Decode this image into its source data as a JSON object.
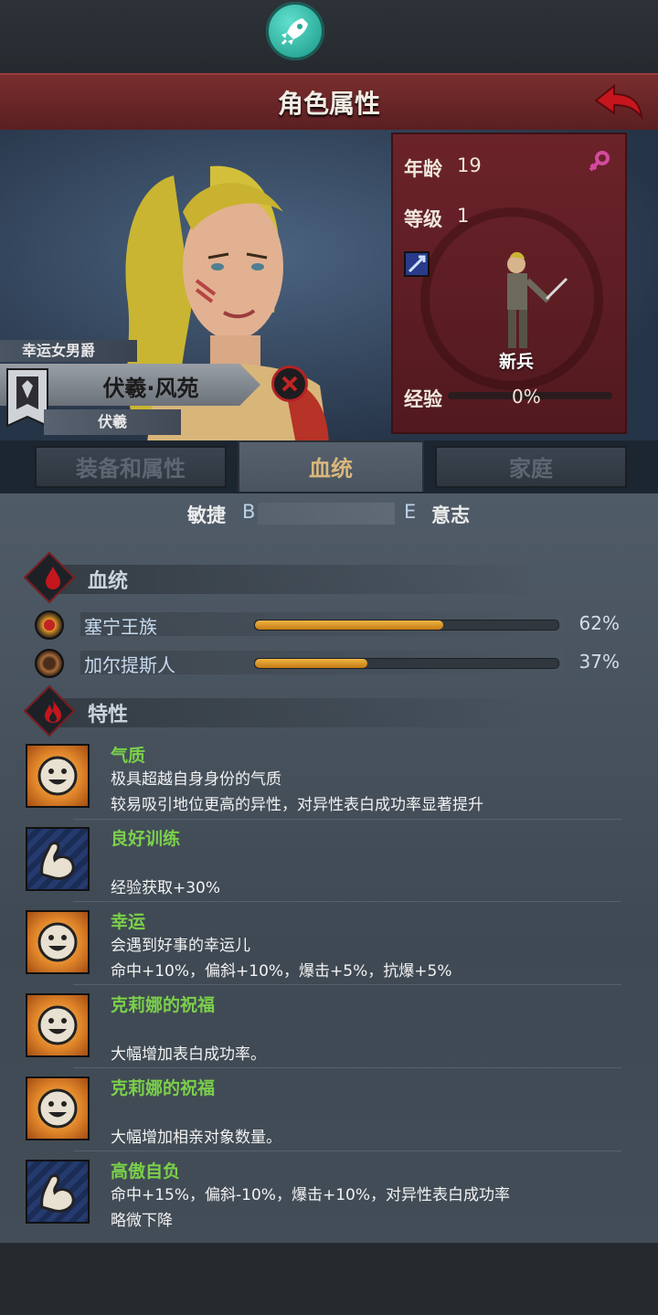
{
  "header": {
    "title": "角色属性"
  },
  "character": {
    "title": "幸运女男爵",
    "name": "伏羲·风苑",
    "dynasty": "伏羲"
  },
  "stats": {
    "age_label": "年龄",
    "age_value": "19",
    "level_label": "等级",
    "level_value": "1",
    "rank": "新兵",
    "exp_label": "经验",
    "exp_value": "0%"
  },
  "tabs": [
    {
      "label": "装备和属性"
    },
    {
      "label": "血统"
    },
    {
      "label": "家庭"
    }
  ],
  "slider": {
    "left_label": "敏捷",
    "left_grade": "B",
    "right_grade": "E",
    "right_label": "意志"
  },
  "bloodline_section": {
    "title": "血统"
  },
  "bloodlines": [
    {
      "name": "塞宁王族",
      "percent": 0.62,
      "percent_label": "62%"
    },
    {
      "name": "加尔提斯人",
      "percent": 0.37,
      "percent_label": "37%"
    }
  ],
  "traits_section": {
    "title": "特性"
  },
  "traits": [
    {
      "icon": "smile-icon",
      "name": "气质",
      "lines": [
        "极具超越自身身份的气质",
        "较易吸引地位更高的异性，对异性表白成功率显著提升"
      ]
    },
    {
      "icon": "arm-icon",
      "name": "良好训练",
      "lines": [
        "",
        "经验获取+30%"
      ]
    },
    {
      "icon": "smile-icon",
      "name": "幸运",
      "lines": [
        "会遇到好事的幸运儿",
        "命中+10%，偏斜+10%，爆击+5%，抗爆+5%"
      ]
    },
    {
      "icon": "smile-icon",
      "name": "克莉娜的祝福",
      "lines": [
        "",
        "大幅增加表白成功率。"
      ]
    },
    {
      "icon": "smile-icon",
      "name": "克莉娜的祝福",
      "lines": [
        "",
        "大幅增加相亲对象数量。"
      ]
    },
    {
      "icon": "arm-icon",
      "name": "高傲自负",
      "lines": [
        "命中+15%，偏斜-10%，爆击+10%，对异性表白成功率",
        "略微下降"
      ]
    }
  ],
  "colors": {
    "accent_gold": "#e9a737",
    "trait_green": "#7bd04a",
    "header_red": "#6b2329"
  }
}
